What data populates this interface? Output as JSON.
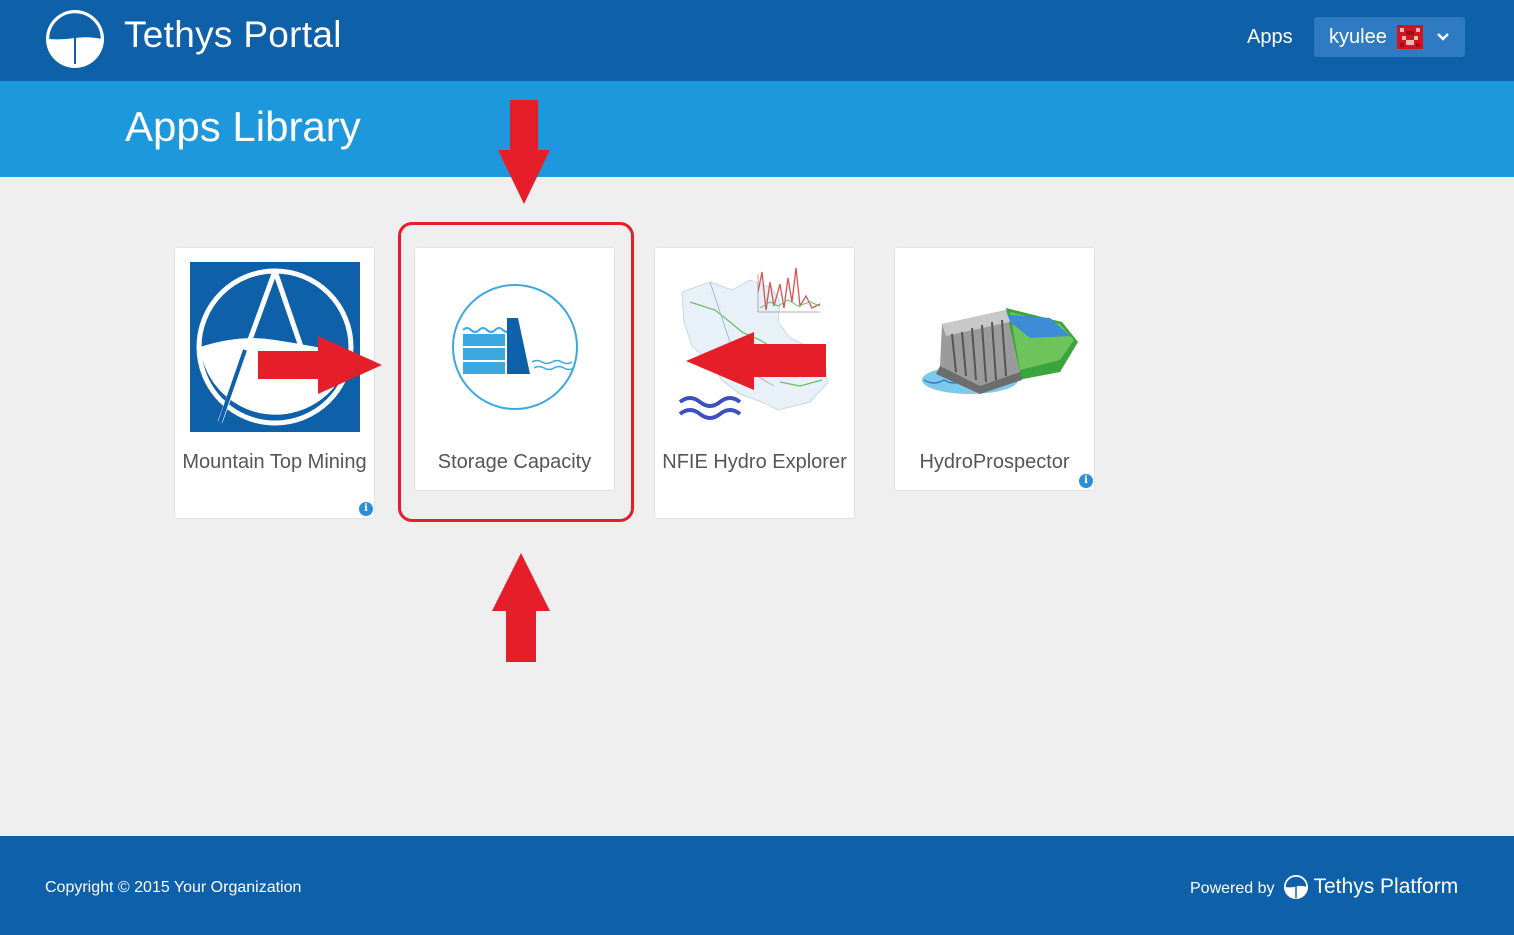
{
  "header": {
    "title": "Tethys Portal",
    "nav_apps": "Apps",
    "user": {
      "name": "kyulee"
    }
  },
  "page": {
    "title": "Apps Library"
  },
  "apps": [
    {
      "name": "Mountain Top Mining",
      "has_info": true
    },
    {
      "name": "Storage Capacity",
      "has_info": false
    },
    {
      "name": "NFIE Hydro Explorer",
      "has_info": false
    },
    {
      "name": "HydroProspector",
      "has_info": true
    }
  ],
  "info_glyph": "i",
  "annotation": {
    "color": "#e61e29",
    "highlighted_app": "Storage Capacity"
  },
  "footer": {
    "copyright": "Copyright © 2015 Your Organization",
    "powered_by": "Powered by",
    "platform": "Tethys Platform"
  },
  "colors": {
    "header_bg": "#0e60a9",
    "titlebar_bg": "#1e98dd",
    "page_bg": "#efefef",
    "annotation_red": "#e61e29"
  }
}
